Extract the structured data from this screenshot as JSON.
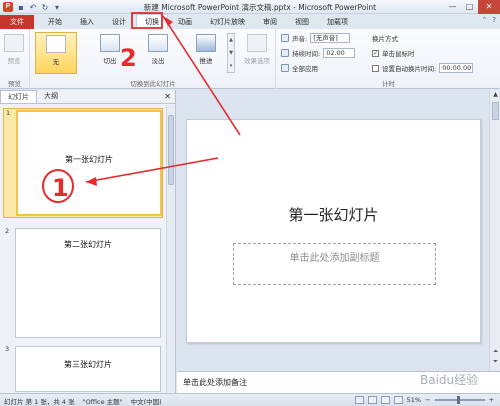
{
  "window": {
    "app_icon": "P",
    "title": "新建 Microsoft PowerPoint 演示文稿.pptx - Microsoft PowerPoint",
    "qat": [
      "save-icon",
      "undo-icon",
      "redo-icon",
      "dropdown-icon"
    ],
    "controls": [
      "minimize-icon",
      "maximize-icon",
      "close-icon"
    ]
  },
  "tabs": [
    {
      "label": "文件"
    },
    {
      "label": "开始"
    },
    {
      "label": "插入"
    },
    {
      "label": "设计"
    },
    {
      "label": "切换"
    },
    {
      "label": "动画"
    },
    {
      "label": "幻灯片放映"
    },
    {
      "label": "审阅"
    },
    {
      "label": "视图"
    },
    {
      "label": "加载项"
    }
  ],
  "ribbon": {
    "preview": {
      "button": "预览",
      "group": "预览"
    },
    "transitions": {
      "group": "切换到此幻灯片",
      "items": [
        {
          "label": "无"
        },
        {
          "label": "切出"
        },
        {
          "label": "淡出"
        },
        {
          "label": "推进"
        }
      ],
      "effect_options": "效果选项"
    },
    "timing": {
      "group": "计时",
      "sound_label": "声音:",
      "sound_value": "[无声音]",
      "duration_label": "持续时间:",
      "duration_value": "02.00",
      "apply_all": "全部应用",
      "advance_header": "换片方式",
      "on_click": "单击鼠标时",
      "after_label": "设置自动换片时间:",
      "after_value": "00:00.00"
    }
  },
  "slides_panel": {
    "tabs": [
      "幻灯片",
      "大纲"
    ],
    "slides": [
      {
        "number": "1",
        "title": "第一张幻灯片"
      },
      {
        "number": "2",
        "title": "第二张幻灯片"
      },
      {
        "number": "3",
        "title": "第三张幻灯片"
      }
    ]
  },
  "slide": {
    "title": "第一张幻灯片",
    "subtitle_placeholder": "单击此处添加副标题"
  },
  "notes_placeholder": "单击此处添加备注",
  "status": {
    "slide_info": "幻灯片 第 1 张，共 4 张",
    "theme": "\"Office 主题\"",
    "language": "中文(中国)",
    "zoom": "51%"
  },
  "annotations": {
    "marker_1": "1",
    "marker_2": "2",
    "color": "#e8292e"
  },
  "watermark": "Baidu经验"
}
